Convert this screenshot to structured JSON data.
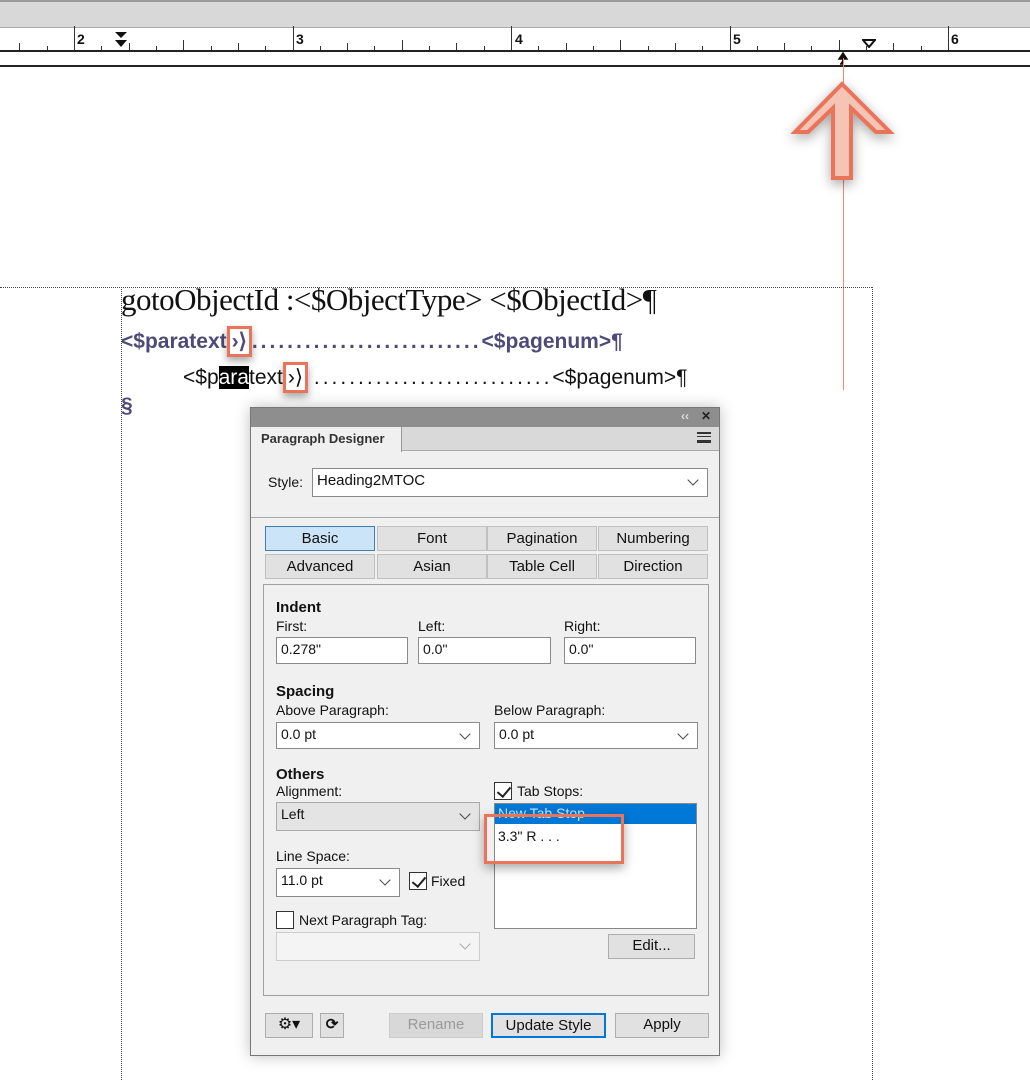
{
  "ruler": {
    "labels": [
      "2",
      "3",
      "4",
      "5",
      "6"
    ]
  },
  "document": {
    "line1": "gotoObjectId :<$ObjectType> <$ObjectId>¶",
    "line2_start": "<$paratext",
    "line2_tab": "›⟩",
    "line2_dots": "..........................",
    "line2_end": "<$pagenum>¶",
    "line3_pre": "<$p",
    "line3_sel": "ara",
    "line3_post": "text",
    "line3_tab": "›⟩",
    "line3_dots": "...........................",
    "line3_end": "<$pagenum>¶",
    "section_mark": "§"
  },
  "accent": {
    "annotation": "#e9745a",
    "selection": "#0078d7"
  },
  "dialog": {
    "title": "Paragraph Designer",
    "collapse": "‹‹",
    "close": "✕",
    "style_label": "Style:",
    "style_value": "Heading2MTOC",
    "tabs": [
      "Basic",
      "Font",
      "Pagination",
      "Numbering",
      "Advanced",
      "Asian",
      "Table Cell",
      "Direction"
    ],
    "active_tab": "Basic",
    "indent": {
      "heading": "Indent",
      "first_label": "First:",
      "first": "0.278\"",
      "left_label": "Left:",
      "left": "0.0\"",
      "right_label": "Right:",
      "right": "0.0\""
    },
    "spacing": {
      "heading": "Spacing",
      "above_label": "Above Paragraph:",
      "above": "0.0 pt",
      "below_label": "Below Paragraph:",
      "below": "0.0 pt"
    },
    "others": {
      "heading": "Others",
      "alignment_label": "Alignment:",
      "alignment": "Left",
      "line_space_label": "Line Space:",
      "line_space": "11.0 pt",
      "fixed_label": "Fixed",
      "fixed": true,
      "next_tag_label": "Next Paragraph Tag:",
      "next_tag": false
    },
    "tab_stops": {
      "label": "Tab Stops:",
      "checked": true,
      "items": [
        "New Tab Stop",
        "3.3\"  R  . . ."
      ],
      "edit": "Edit..."
    },
    "buttons": {
      "rename": "Rename",
      "update": "Update Style",
      "apply": "Apply"
    }
  }
}
